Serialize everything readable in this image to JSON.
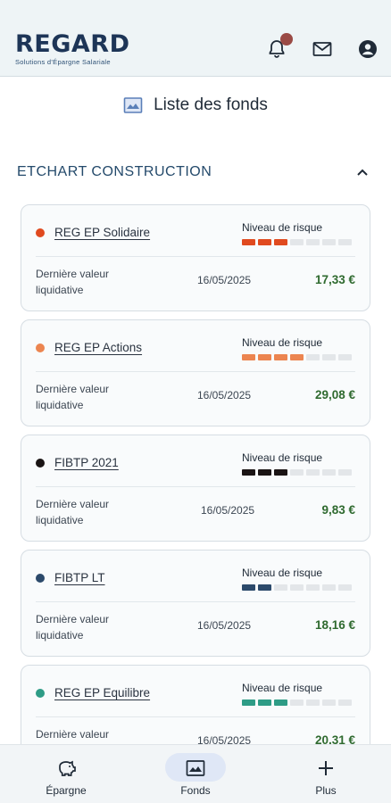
{
  "header": {
    "logo_main": "REGARD",
    "logo_sub": "Solutions d'Épargne Salariale",
    "icons": [
      "bell-icon",
      "mail-icon",
      "account-icon"
    ]
  },
  "page": {
    "title": "Liste des fonds",
    "title_icon": "fund-chart-icon"
  },
  "section": {
    "title": "ETCHART CONSTRUCTION",
    "state": "expanded"
  },
  "labels": {
    "risk": "Niveau de risque",
    "last_value": "Dernière valeur liquidative"
  },
  "funds": [
    {
      "name": "REG EP Solidaire",
      "color": "#e04a1f",
      "risk_level": 3,
      "risk_max": 7,
      "date": "16/05/2025",
      "value": "17,33 €"
    },
    {
      "name": "REG EP Actions",
      "color": "#ec8550",
      "risk_level": 4,
      "risk_max": 7,
      "date": "16/05/2025",
      "value": "29,08 €"
    },
    {
      "name": "FIBTP 2021",
      "color": "#1a1414",
      "risk_level": 3,
      "risk_max": 7,
      "date": "16/05/2025",
      "value": "9,83 €"
    },
    {
      "name": "FIBTP LT",
      "color": "#2c4a6b",
      "risk_level": 2,
      "risk_max": 7,
      "date": "16/05/2025",
      "value": "18,16 €"
    },
    {
      "name": "REG EP Equilibre",
      "color": "#2e9c86",
      "risk_level": 3,
      "risk_max": 7,
      "date": "16/05/2025",
      "value": "20,31 €"
    }
  ],
  "bottom_nav": [
    {
      "label": "Épargne",
      "icon": "piggy-bank-icon",
      "active": false
    },
    {
      "label": "Fonds",
      "icon": "fund-chart-icon",
      "active": true
    },
    {
      "label": "Plus",
      "icon": "plus-icon",
      "active": false
    }
  ]
}
